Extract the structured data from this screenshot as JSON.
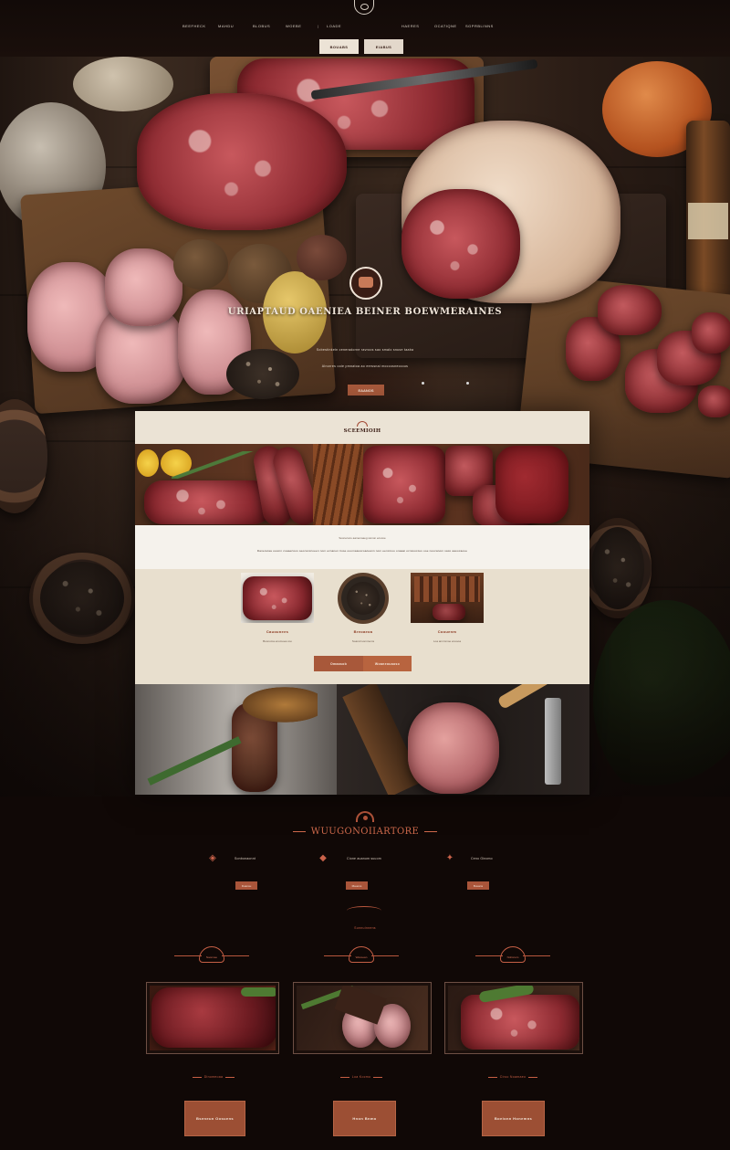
{
  "nav": {
    "items": [
      "Beefheck",
      "Mahdu",
      "Blobus",
      "Woebe",
      "Loade",
      "Haeres",
      "Ocatiqne",
      "Sgprblinns"
    ],
    "btn_a": "Bouabs",
    "btn_b": "Eiabus"
  },
  "hero": {
    "title": "URIAPTAUD OAENIEA  BEINER  BOEWMERAINES",
    "subtitle1": "Sobestinkein ceneradorne ravroos sao smalo snuse taaba",
    "subtitle2": "Alnorres ooie pmnatoa ao eerssnai moccosneccous",
    "button": "Eaanos"
  },
  "panel": {
    "title": "SCEEMIOIH",
    "text_line1": "Sooneroco aamenoaeg ssmon ecocoe",
    "text_line2": "Daneiocaa ooomn coaaerioos seocanccoeen nom ecnanen tiuse ooomaauscoaceann nom eencmoo onaaai ocnssucces ooe noocanom saco aaoocaoue",
    "cards": [
      {
        "title": "Cauounees",
        "sub": "Boonoma enomoea coo"
      },
      {
        "title": "Breoaeoa",
        "sub": "Soamd sonnnems"
      },
      {
        "title": "Coouenm",
        "sub": "Loa annmmoe enoooa"
      }
    ],
    "btn_left": "Omaasob",
    "btn_right": "Woaneouaoso"
  },
  "lower": {
    "title": "WUUGONOIIARTORE",
    "features": [
      {
        "icon": "meat-icon",
        "label": "Sonbonaonnt",
        "btn": "Duanou"
      },
      {
        "icon": "steak-icon",
        "label": "Cione  auanum  suuom",
        "btn": "Mauons"
      },
      {
        "icon": "grill-icon",
        "label": "Ceno  Ginomo",
        "btn": "Buuans"
      }
    ],
    "mini_text": "Sunnuinnens",
    "ribbons": [
      "Naonnee",
      "Wanoean",
      "Nohsnom"
    ],
    "captions": [
      "Dinomeoaa",
      "Loa Kocmo",
      "Ciroo Noamaeo"
    ],
    "buttons": [
      "Bseneun Oosuens",
      "Hnon  Bnmo",
      "Boeionn Honemns"
    ]
  },
  "colors": {
    "accent": "#a9553a",
    "cream": "#ebe3d5",
    "dark": "#100806"
  }
}
